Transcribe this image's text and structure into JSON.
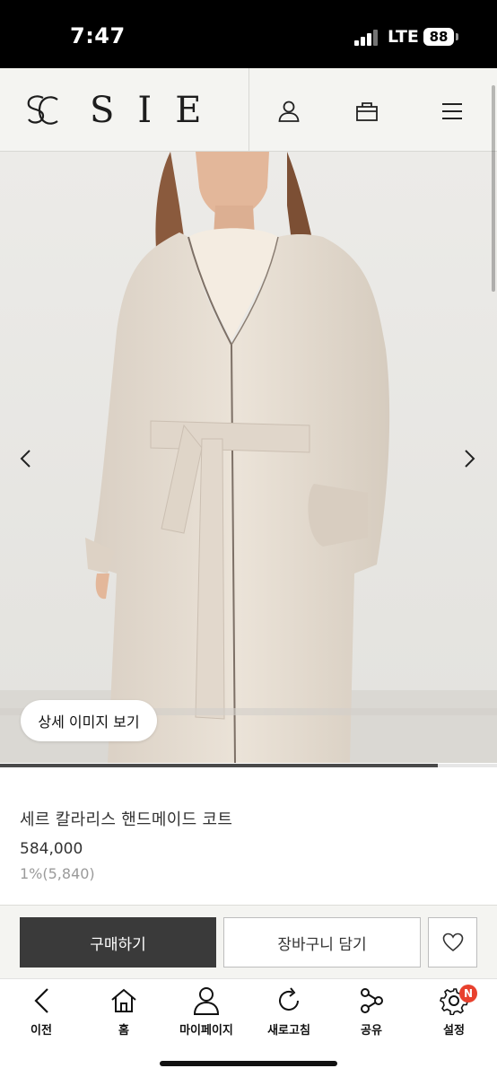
{
  "status_bar": {
    "time": "7:47",
    "network": "LTE",
    "battery": "88"
  },
  "header": {
    "brand": "SIE",
    "icons": [
      "user-icon",
      "shopping-bag-icon",
      "menu-icon"
    ]
  },
  "gallery": {
    "detail_button_label": "상세 이미지 보기",
    "progress": 0.88
  },
  "product": {
    "name": "세르 칼라리스 핸드메이드 코트",
    "price": "584,000",
    "points": "1%(5,840)"
  },
  "purchase_bar": {
    "buy_label": "구매하기",
    "cart_label": "장바구니 담기"
  },
  "bottom_nav": {
    "items": [
      {
        "label": "이전",
        "icon": "back-icon"
      },
      {
        "label": "홈",
        "icon": "home-icon"
      },
      {
        "label": "마이페이지",
        "icon": "person-icon"
      },
      {
        "label": "새로고침",
        "icon": "refresh-icon"
      },
      {
        "label": "공유",
        "icon": "share-icon"
      },
      {
        "label": "설정",
        "icon": "settings-icon",
        "badge": "N"
      }
    ]
  },
  "colors": {
    "header_bg": "#f4f4f1",
    "buy_button": "#3a3a3a",
    "badge": "#e8412e",
    "coat": "#e6ddd1"
  }
}
